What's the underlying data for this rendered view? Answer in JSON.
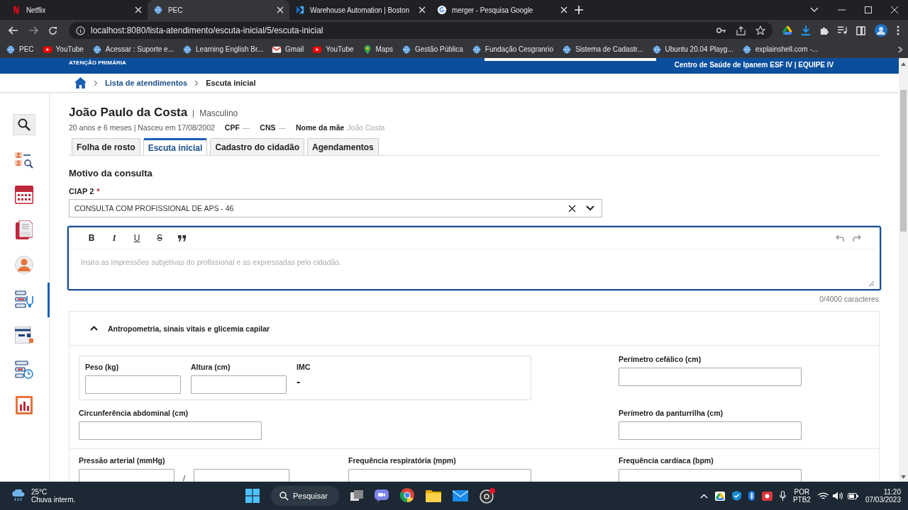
{
  "browser": {
    "tabs": [
      {
        "title": "Netflix",
        "selected": false,
        "kind": "netflix"
      },
      {
        "title": "PEC",
        "selected": true,
        "kind": "globe"
      },
      {
        "title": "Warehouse Automation | Boston",
        "selected": false,
        "kind": "flag"
      },
      {
        "title": "merger - Pesquisa Google",
        "selected": false,
        "kind": "google"
      }
    ],
    "url": "localhost:8080/lista-atendimento/escuta-inicial/5/escuta-inicial",
    "bookmarks": [
      {
        "title": "PEC",
        "kind": "globe"
      },
      {
        "title": "YouTube",
        "kind": "youtube"
      },
      {
        "title": "Acessar : Suporte e...",
        "kind": "globe"
      },
      {
        "title": "Learning English Br...",
        "kind": "globe"
      },
      {
        "title": "Gmail",
        "kind": "gmail"
      },
      {
        "title": "YouTube",
        "kind": "youtube"
      },
      {
        "title": "Maps",
        "kind": "maps"
      },
      {
        "title": "Gestão Pública",
        "kind": "globe"
      },
      {
        "title": "Fundação Cesgranrio",
        "kind": "globe"
      },
      {
        "title": "Sistema de Cadastr...",
        "kind": "globe"
      },
      {
        "title": "Ubuntu 20.04 Playg...",
        "kind": "globe"
      },
      {
        "title": "explainshell.com -...",
        "kind": "globe"
      }
    ]
  },
  "app": {
    "brand": "ATENÇÃO PRIMÁRIA",
    "unit": "Centro de Saúde de Ipanem ESF IV | EQUIPE IV",
    "breadcrumb": [
      {
        "label": "Lista de atendimentos",
        "kind": "link"
      },
      {
        "label": "Escuta inicial",
        "kind": "current"
      }
    ],
    "sidebar": [
      {
        "kind": "search",
        "selected": false
      },
      {
        "kind": "queue",
        "selected": false
      },
      {
        "kind": "calendar",
        "selected": false
      },
      {
        "kind": "cds",
        "selected": false
      },
      {
        "kind": "person",
        "selected": false
      },
      {
        "kind": "care",
        "selected": true
      },
      {
        "kind": "box",
        "selected": false
      },
      {
        "kind": "schedule",
        "selected": false
      },
      {
        "kind": "report",
        "selected": false
      }
    ]
  },
  "patient": {
    "name": "João Paulo da Costa",
    "sex": "Masculino",
    "age": "20 anos e 6 meses | Nasceu em 17/08/2002",
    "fields": [
      {
        "label": "CPF",
        "value": "—"
      },
      {
        "label": "CNS",
        "value": "—"
      },
      {
        "label": "Nome da mãe",
        "value": "João Costa"
      }
    ]
  },
  "tabs": [
    {
      "label": "Folha de rosto",
      "selected": false
    },
    {
      "label": "Escuta inicial",
      "selected": true
    },
    {
      "label": "Cadastro do cidadão",
      "selected": false
    },
    {
      "label": "Agendamentos",
      "selected": false
    }
  ],
  "reason": {
    "title": "Motivo da consulta",
    "ciap_label": "CIAP 2",
    "required": true,
    "required_mark": "*",
    "ciap_value": "CONSULTA COM PROFISSIONAL DE APS - 46",
    "toolbar": [
      "B",
      "I",
      "U",
      "S"
    ],
    "placeholder": "Insira as impressões subjetivas do profissional e as expressadas pelo cidadão.",
    "counter": "0/4000 caracteres"
  },
  "vitals": {
    "title": "Antropometria, sinais vitais e glicemia capilar",
    "expanded": true,
    "weight": "Peso (kg)",
    "height": "Altura (cm)",
    "bmi_label": "IMC",
    "bmi_value": "-",
    "head": "Perímetro cefálico (cm)",
    "abdominal": "Circunferência abdominal (cm)",
    "calf": "Perímetro da panturrilha (cm)",
    "pressure": "Pressão arterial (mmHg)",
    "pressure_separator": "/",
    "respiratory": "Frequência respiratória (mpm)",
    "heart": "Frequência cardíaca (bpm)"
  },
  "taskbar": {
    "temperature": "25°C",
    "weather": "Chuva interm.",
    "search": "Pesquisar",
    "language": "POR",
    "layout": "PTB2",
    "time": "11:20",
    "date": "07/03/2023"
  }
}
